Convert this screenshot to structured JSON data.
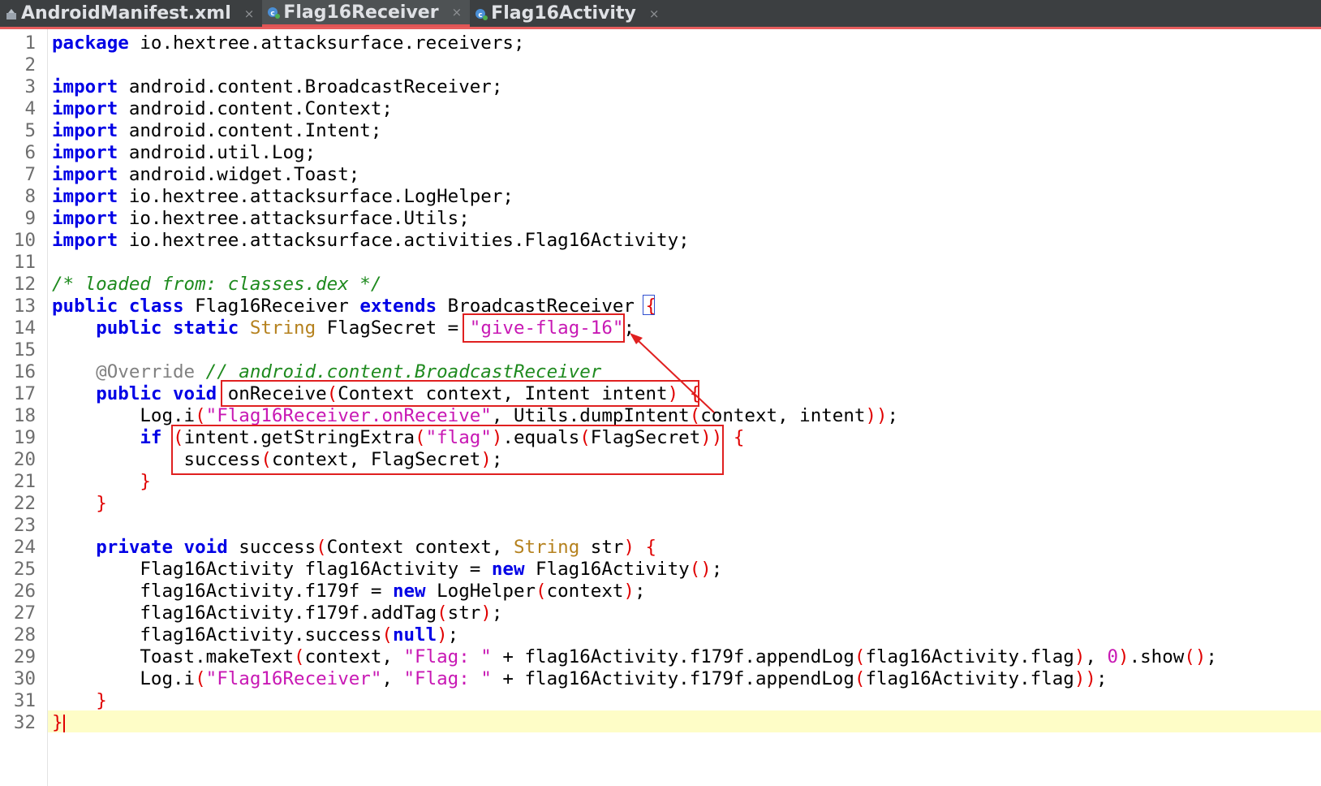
{
  "tabs": [
    {
      "label": "AndroidManifest.xml",
      "icon": "xml-file-icon",
      "active": false
    },
    {
      "label": "Flag16Receiver",
      "icon": "java-class-icon",
      "active": true
    },
    {
      "label": "Flag16Activity",
      "icon": "java-class-icon",
      "active": false
    }
  ],
  "tab_close_glyph": "×",
  "editor": {
    "lines": [
      {
        "n": "1",
        "tokens": [
          [
            "kw",
            "package"
          ],
          [
            "pl",
            " io.hextree.attacksurface.receivers;"
          ]
        ]
      },
      {
        "n": "2",
        "tokens": []
      },
      {
        "n": "3",
        "tokens": [
          [
            "kw",
            "import"
          ],
          [
            "pl",
            " android.content.BroadcastReceiver;"
          ]
        ]
      },
      {
        "n": "4",
        "tokens": [
          [
            "kw",
            "import"
          ],
          [
            "pl",
            " android.content.Context;"
          ]
        ]
      },
      {
        "n": "5",
        "tokens": [
          [
            "kw",
            "import"
          ],
          [
            "pl",
            " android.content.Intent;"
          ]
        ]
      },
      {
        "n": "6",
        "tokens": [
          [
            "kw",
            "import"
          ],
          [
            "pl",
            " android.util.Log;"
          ]
        ]
      },
      {
        "n": "7",
        "tokens": [
          [
            "kw",
            "import"
          ],
          [
            "pl",
            " android.widget.Toast;"
          ]
        ]
      },
      {
        "n": "8",
        "tokens": [
          [
            "kw",
            "import"
          ],
          [
            "pl",
            " io.hextree.attacksurface.LogHelper;"
          ]
        ]
      },
      {
        "n": "9",
        "tokens": [
          [
            "kw",
            "import"
          ],
          [
            "pl",
            " io.hextree.attacksurface.Utils;"
          ]
        ]
      },
      {
        "n": "10",
        "tokens": [
          [
            "kw",
            "import"
          ],
          [
            "pl",
            " io.hextree.attacksurface.activities.Flag16Activity;"
          ]
        ]
      },
      {
        "n": "11",
        "tokens": []
      },
      {
        "n": "12",
        "tokens": [
          [
            "cm",
            "/* loaded from: classes.dex */"
          ]
        ]
      },
      {
        "n": "13",
        "tokens": [
          [
            "kw",
            "public class"
          ],
          [
            "pl",
            " Flag16Receiver "
          ],
          [
            "kw",
            "extends"
          ],
          [
            "pl",
            " BroadcastReceiver "
          ],
          [
            "pa",
            "{"
          ]
        ]
      },
      {
        "n": "14",
        "tokens": [
          [
            "pl",
            "    "
          ],
          [
            "kw",
            "public static"
          ],
          [
            "pl",
            " "
          ],
          [
            "ty",
            "String"
          ],
          [
            "pl",
            " FlagSecret = "
          ],
          [
            "st",
            "\"give-flag-16\""
          ],
          [
            "pl",
            ";"
          ]
        ]
      },
      {
        "n": "15",
        "tokens": []
      },
      {
        "n": "16",
        "tokens": [
          [
            "an",
            "    @Override"
          ],
          [
            "pl",
            " "
          ],
          [
            "cm",
            "// android.content.BroadcastReceiver"
          ]
        ]
      },
      {
        "n": "17",
        "tokens": [
          [
            "pl",
            "    "
          ],
          [
            "kw",
            "public void"
          ],
          [
            "pl",
            " onReceive"
          ],
          [
            "pa",
            "("
          ],
          [
            "pl",
            "Context context, Intent intent"
          ],
          [
            "pa",
            ")"
          ],
          [
            "pl",
            " "
          ],
          [
            "pa",
            "{"
          ]
        ]
      },
      {
        "n": "18",
        "tokens": [
          [
            "pl",
            "        Log.i"
          ],
          [
            "pa",
            "("
          ],
          [
            "st",
            "\"Flag16Receiver.onReceive\""
          ],
          [
            "pl",
            ", Utils.dumpIntent"
          ],
          [
            "pa",
            "("
          ],
          [
            "pl",
            "context, intent"
          ],
          [
            "pa",
            "))"
          ],
          [
            "pl",
            ";"
          ]
        ]
      },
      {
        "n": "19",
        "tokens": [
          [
            "pl",
            "        "
          ],
          [
            "kw",
            "if"
          ],
          [
            "pl",
            " "
          ],
          [
            "pa",
            "("
          ],
          [
            "pl",
            "intent.getStringExtra"
          ],
          [
            "pa",
            "("
          ],
          [
            "st",
            "\"flag\""
          ],
          [
            "pa",
            ")"
          ],
          [
            "pl",
            ".equals"
          ],
          [
            "pa",
            "("
          ],
          [
            "pl",
            "FlagSecret"
          ],
          [
            "pa",
            "))"
          ],
          [
            "pl",
            " "
          ],
          [
            "pa",
            "{"
          ]
        ]
      },
      {
        "n": "20",
        "tokens": [
          [
            "pl",
            "            success"
          ],
          [
            "pa",
            "("
          ],
          [
            "pl",
            "context, FlagSecret"
          ],
          [
            "pa",
            ")"
          ],
          [
            "pl",
            ";"
          ]
        ]
      },
      {
        "n": "21",
        "tokens": [
          [
            "pl",
            "        "
          ],
          [
            "pa",
            "}"
          ]
        ]
      },
      {
        "n": "22",
        "tokens": [
          [
            "pl",
            "    "
          ],
          [
            "pa",
            "}"
          ]
        ]
      },
      {
        "n": "23",
        "tokens": []
      },
      {
        "n": "24",
        "tokens": [
          [
            "pl",
            "    "
          ],
          [
            "kw",
            "private void"
          ],
          [
            "pl",
            " success"
          ],
          [
            "pa",
            "("
          ],
          [
            "pl",
            "Context context, "
          ],
          [
            "ty",
            "String"
          ],
          [
            "pl",
            " str"
          ],
          [
            "pa",
            ")"
          ],
          [
            "pl",
            " "
          ],
          [
            "pa",
            "{"
          ]
        ]
      },
      {
        "n": "25",
        "tokens": [
          [
            "pl",
            "        Flag16Activity flag16Activity = "
          ],
          [
            "kw",
            "new"
          ],
          [
            "pl",
            " Flag16Activity"
          ],
          [
            "pa",
            "()"
          ],
          [
            "pl",
            ";"
          ]
        ]
      },
      {
        "n": "26",
        "tokens": [
          [
            "pl",
            "        flag16Activity.f179f = "
          ],
          [
            "kw",
            "new"
          ],
          [
            "pl",
            " LogHelper"
          ],
          [
            "pa",
            "("
          ],
          [
            "pl",
            "context"
          ],
          [
            "pa",
            ")"
          ],
          [
            "pl",
            ";"
          ]
        ]
      },
      {
        "n": "27",
        "tokens": [
          [
            "pl",
            "        flag16Activity.f179f.addTag"
          ],
          [
            "pa",
            "("
          ],
          [
            "pl",
            "str"
          ],
          [
            "pa",
            ")"
          ],
          [
            "pl",
            ";"
          ]
        ]
      },
      {
        "n": "28",
        "tokens": [
          [
            "pl",
            "        flag16Activity.success"
          ],
          [
            "pa",
            "("
          ],
          [
            "kw",
            "null"
          ],
          [
            "pa",
            ")"
          ],
          [
            "pl",
            ";"
          ]
        ]
      },
      {
        "n": "29",
        "tokens": [
          [
            "pl",
            "        Toast.makeText"
          ],
          [
            "pa",
            "("
          ],
          [
            "pl",
            "context, "
          ],
          [
            "st",
            "\"Flag: \""
          ],
          [
            "pl",
            " + flag16Activity.f179f.appendLog"
          ],
          [
            "pa",
            "("
          ],
          [
            "pl",
            "flag16Activity.flag"
          ],
          [
            "pa",
            ")"
          ],
          [
            "pl",
            ", "
          ],
          [
            "st",
            "0"
          ],
          [
            "pa",
            ")"
          ],
          [
            "pl",
            ".show"
          ],
          [
            "pa",
            "()"
          ],
          [
            "pl",
            ";"
          ]
        ]
      },
      {
        "n": "30",
        "tokens": [
          [
            "pl",
            "        Log.i"
          ],
          [
            "pa",
            "("
          ],
          [
            "st",
            "\"Flag16Receiver\""
          ],
          [
            "pl",
            ", "
          ],
          [
            "st",
            "\"Flag: \""
          ],
          [
            "pl",
            " + flag16Activity.f179f.appendLog"
          ],
          [
            "pa",
            "("
          ],
          [
            "pl",
            "flag16Activity.flag"
          ],
          [
            "pa",
            "))"
          ],
          [
            "pl",
            ";"
          ]
        ]
      },
      {
        "n": "31",
        "tokens": [
          [
            "pl",
            "    "
          ],
          [
            "pa",
            "}"
          ]
        ]
      },
      {
        "n": "32",
        "tokens": [
          [
            "pa",
            "}"
          ]
        ]
      }
    ],
    "current_line": "32"
  },
  "annotations": {
    "color": "#e02020",
    "boxes": [
      "flag-secret-value-box",
      "onreceive-signature-box",
      "flag-check-condition-box"
    ],
    "arrow": "arrow-from-onreceive-to-flag-secret"
  }
}
